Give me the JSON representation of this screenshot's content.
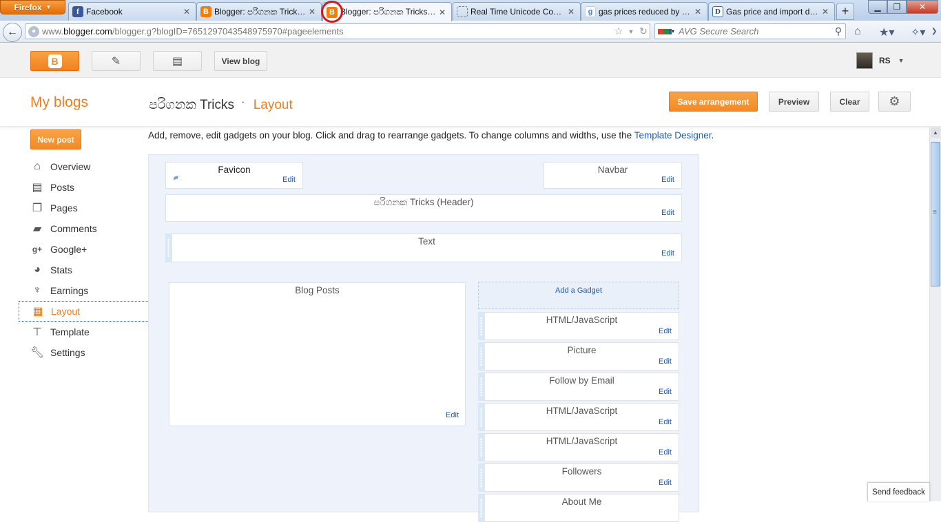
{
  "browser": {
    "app_button": "Firefox",
    "tabs": [
      {
        "title": "Facebook",
        "icon": "facebook-icon"
      },
      {
        "title": "Blogger: පරිගනක Tricks ...",
        "icon": "blogger-icon"
      },
      {
        "title": "Blogger: පරිගනක Tricks ...",
        "icon": "blogger-icon",
        "active": true
      },
      {
        "title": "Real Time Unicode Conv...",
        "icon": "blank-page-icon"
      },
      {
        "title": "gas prices reduced by rs ...",
        "icon": "google-icon"
      },
      {
        "title": "Gas price and import dut...",
        "icon": "d-site-icon"
      }
    ],
    "new_tab": "+",
    "url_prefix": "www.",
    "url_domain": "blogger.com",
    "url_rest": "/blogger.g?blogID=7651297043548975970#pageelements",
    "search_placeholder": "AVG Secure Search",
    "highlight_color": "#d31a1a"
  },
  "blogger_bar": {
    "view_blog": "View blog",
    "username": "RS"
  },
  "header": {
    "my_blogs": "My blogs",
    "blog_name": "පරිගනක Tricks",
    "separator": "·",
    "page_name": "Layout",
    "save": "Save arrangement",
    "preview": "Preview",
    "clear": "Clear"
  },
  "sidebar": {
    "new_post": "New post",
    "items": [
      {
        "label": "Overview",
        "icon": "home-icon"
      },
      {
        "label": "Posts",
        "icon": "posts-icon"
      },
      {
        "label": "Pages",
        "icon": "pages-icon"
      },
      {
        "label": "Comments",
        "icon": "comments-icon"
      },
      {
        "label": "Google+",
        "icon": "google-plus-icon"
      },
      {
        "label": "Stats",
        "icon": "stats-pie-icon"
      },
      {
        "label": "Earnings",
        "icon": "trophy-icon"
      },
      {
        "label": "Layout",
        "icon": "layout-icon",
        "active": true
      },
      {
        "label": "Template",
        "icon": "paint-roller-icon"
      },
      {
        "label": "Settings",
        "icon": "wrench-icon"
      }
    ]
  },
  "main": {
    "intro_text": "Add, remove, edit gadgets on your blog. Click and drag to rearrange gadgets. To change columns and widths, use the ",
    "intro_link": "Template Designer",
    "intro_end": ".",
    "edit_label": "Edit",
    "gadgets": {
      "favicon": "Favicon",
      "navbar": "Navbar",
      "header": "පරිගනක Tricks (Header)",
      "text": "Text",
      "blog_posts": "Blog Posts",
      "add_gadget": "Add a Gadget",
      "sidebar_gadgets": [
        "HTML/JavaScript",
        "Picture",
        "Follow by Email",
        "HTML/JavaScript",
        "HTML/JavaScript",
        "Followers",
        "About Me"
      ]
    }
  },
  "footer": {
    "send_feedback": "Send feedback"
  },
  "colors": {
    "accent_orange": "#f07e21",
    "link_blue": "#2159a5",
    "canvas_bg": "#eef3fb"
  }
}
